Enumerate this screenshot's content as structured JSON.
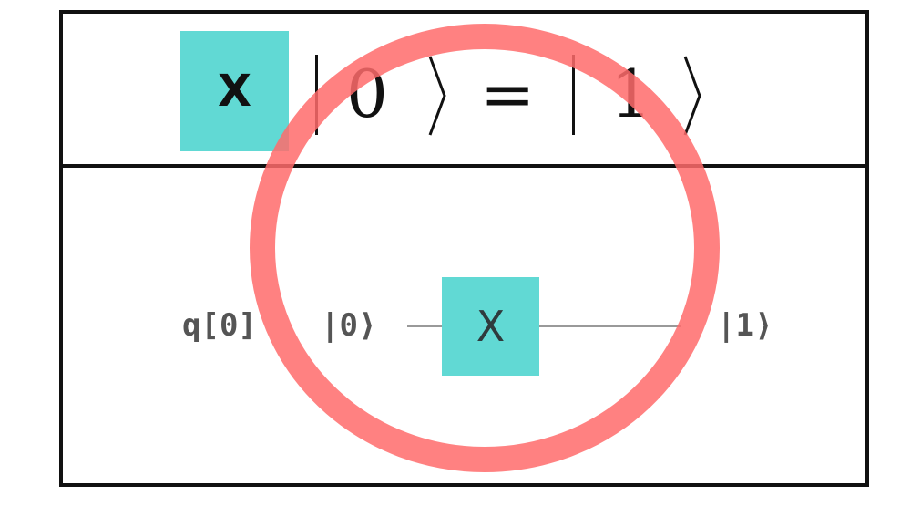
{
  "equation": {
    "gate_label": "X",
    "input_state": "0",
    "equals": "=",
    "output_state": "1"
  },
  "circuit": {
    "qubit_label": "q[0]",
    "input_ket": "|0⟩",
    "gate_label": "X",
    "output_ket": "|1⟩"
  },
  "colors": {
    "gate_fill": "#61d9d4",
    "highlight_ring": "#ff6b6b",
    "wire": "#999999",
    "border": "#111111"
  }
}
